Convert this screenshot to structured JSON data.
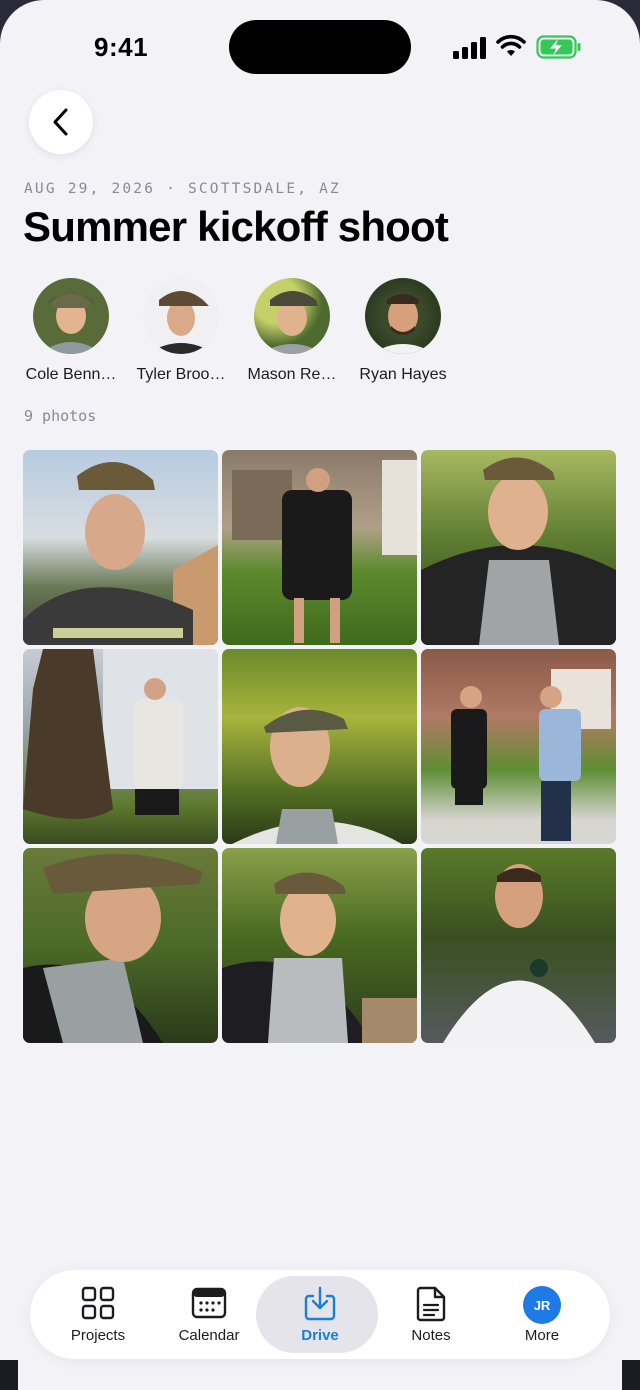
{
  "status": {
    "time": "9:41"
  },
  "header": {
    "meta": "AUG 29, 2026 · SCOTTSDALE, AZ",
    "title": "Summer kickoff shoot"
  },
  "people": [
    {
      "name": "Cole Bennett",
      "display": "Cole Benn…"
    },
    {
      "name": "Tyler Brooks",
      "display": "Tyler Broo…"
    },
    {
      "name": "Mason Reed",
      "display": "Mason Re…"
    },
    {
      "name": "Ryan Hayes",
      "display": "Ryan Hayes"
    }
  ],
  "photos": {
    "count_label": "9 photos",
    "items": [
      {
        "desc": "portrait-elevate-sweatshirt"
      },
      {
        "desc": "walking-front-yard"
      },
      {
        "desc": "smiling-quarter-zip"
      },
      {
        "desc": "by-tree-with-folder"
      },
      {
        "desc": "looking-up-backlit"
      },
      {
        "desc": "handshake-driveway"
      },
      {
        "desc": "profile-camo-cap"
      },
      {
        "desc": "standing-treeline"
      },
      {
        "desc": "white-windbreaker-smile"
      }
    ]
  },
  "tabbar": {
    "tabs": [
      {
        "label": "Projects",
        "icon": "grid-icon"
      },
      {
        "label": "Calendar",
        "icon": "calendar-icon"
      },
      {
        "label": "Drive",
        "icon": "download-icon",
        "active": true
      },
      {
        "label": "Notes",
        "icon": "document-icon"
      },
      {
        "label": "More",
        "icon": "avatar-initials",
        "initials": "JR"
      }
    ]
  },
  "colors": {
    "accent": "#1a7fd6",
    "avatar_bg": "#1e7ae6",
    "background": "#f2f2f7"
  }
}
